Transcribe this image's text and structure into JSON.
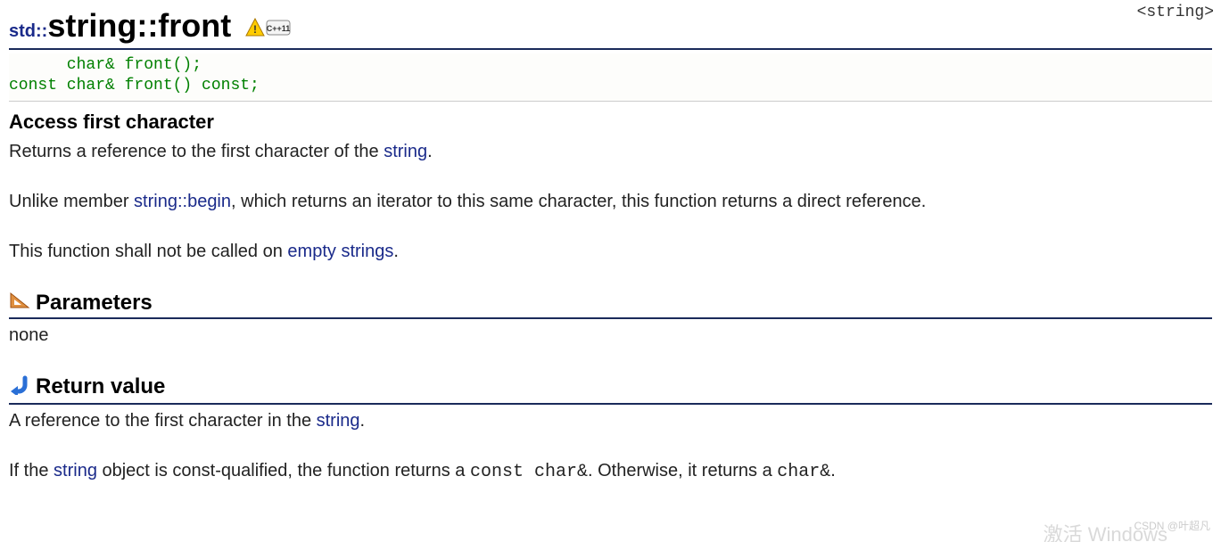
{
  "header_link": "<string>",
  "title": {
    "ns": "std::",
    "name": "string::front"
  },
  "badge": {
    "name": "cpp11-warning-icon",
    "text": "C++11"
  },
  "signature": "      char& front();\nconst char& front() const;",
  "summary": "Access first character",
  "p1": {
    "pre": "Returns a reference to the first character of the ",
    "link": "string",
    "post": "."
  },
  "p2": {
    "pre": "Unlike member ",
    "link": "string::begin",
    "post": ", which returns an iterator to this same character, this function returns a direct reference."
  },
  "p3": {
    "pre": "This function shall not be called on ",
    "link": "empty strings",
    "post": "."
  },
  "sections": {
    "parameters": {
      "heading": "Parameters",
      "body": "none"
    },
    "return": {
      "heading": "Return value"
    }
  },
  "ret1": {
    "pre": "A reference to the first character in the ",
    "link": "string",
    "post": "."
  },
  "ret2": {
    "t1": "If the ",
    "link": "string",
    "t2": " object is const-qualified, the function returns a ",
    "code1": "const char&",
    "t3": ". Otherwise, it returns a ",
    "code2": "char&",
    "t4": "."
  },
  "watermark": "CSDN @叶超凡",
  "watermark2": "激活 Windows"
}
